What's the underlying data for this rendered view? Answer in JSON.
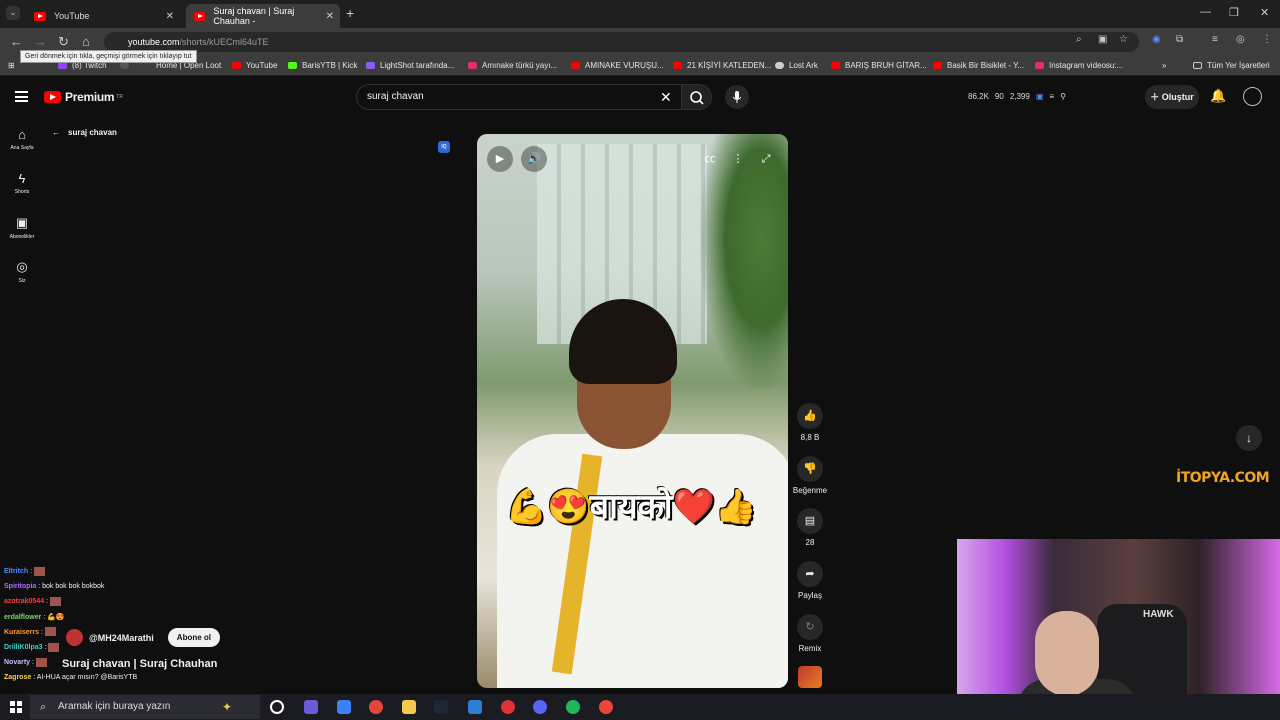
{
  "browser": {
    "tabs": [
      {
        "title": "YouTube",
        "active": false
      },
      {
        "title": "Suraj chavan | Suraj Chauhan -",
        "active": true
      }
    ],
    "url_host": "youtube.com",
    "url_path": "/shorts/kUECml64uTE",
    "tooltip": "Geri dönmek için tıkla, geçmişi görmek için tıklayıp tut",
    "bookmarks": [
      {
        "label": "(8) Twitch",
        "color": "#9146ff"
      },
      {
        "label": "Home | Open Loot",
        "color": "#2e2e2e"
      },
      {
        "label": "YouTube",
        "color": "#ff0000"
      },
      {
        "label": "BarisYTB | Kick",
        "color": "#53fc18"
      },
      {
        "label": "LightShot tarafında...",
        "color": "#8b5cf6"
      },
      {
        "label": "Amınake türkü yayı...",
        "color": "#e1306c"
      },
      {
        "label": "AMINAKE VURUŞU...",
        "color": "#ff0000"
      },
      {
        "label": "21 KİŞİYİ KATLEDEN...",
        "color": "#ff0000"
      },
      {
        "label": "Lost Ark",
        "color": "#cccccc"
      },
      {
        "label": "BARIŞ BRUH GİTAR...",
        "color": "#ff0000"
      },
      {
        "label": "Basik Bir Bisiklet - Y...",
        "color": "#ff0000"
      },
      {
        "label": "Instagram videosu:...",
        "color": "#e1306c"
      }
    ],
    "all_bookmarks": "Tüm Yer İşaretleri"
  },
  "youtube": {
    "logo_text": "Premium",
    "logo_sup": "TR",
    "search_value": "suraj chavan",
    "stats": [
      "86.2K",
      "90",
      "2,399"
    ],
    "create_label": "Oluştur",
    "sidebar": [
      {
        "label": "Ana Sayfa",
        "icon": "home-icon"
      },
      {
        "label": "Shorts",
        "icon": "shorts-icon"
      },
      {
        "label": "Abonelikler",
        "icon": "subscriptions-icon"
      },
      {
        "label": "Siz",
        "icon": "you-icon"
      }
    ],
    "back_label": "suraj chavan",
    "video": {
      "caption": "💪😍बायको❤️👍",
      "channel": "@MH24Marathi",
      "subscribe_label": "Abone ol",
      "title": "Suraj chavan | Suraj Chauhan"
    },
    "actions": {
      "like_count": "8,8 B",
      "dislike_label": "Beğenme",
      "comments_count": "28",
      "share_label": "Paylaş",
      "remix_label": "Remix"
    }
  },
  "overlay": {
    "chat": [
      {
        "user": "Eltritch",
        "msg": ":",
        "color": "#4f8cff"
      },
      {
        "user": "Spiritopia",
        "msg": ": bok bok bok bokbok",
        "color": "#b06bff"
      },
      {
        "user": "azotrak0544",
        "msg": ":",
        "color": "#ff3b3b"
      },
      {
        "user": "erdalflower",
        "msg": ": 💪😍",
        "color": "#7bd36b"
      },
      {
        "user": "Kuraiserrs",
        "msg": ":",
        "color": "#ff9a3b"
      },
      {
        "user": "DrilliK0lpa3",
        "msg": ":",
        "color": "#3bd0c8"
      },
      {
        "user": "Novarty",
        "msg": ":",
        "color": "#c0c0ff"
      },
      {
        "user": "Zagrose",
        "msg": ": AI-HUA açar mısın? @BarisYTB",
        "color": "#ffd24a"
      }
    ],
    "itopya": "İTOPYA.COM",
    "hawk": "HAWK"
  },
  "taskbar": {
    "search_placeholder": "Aramak için buraya yazın"
  }
}
